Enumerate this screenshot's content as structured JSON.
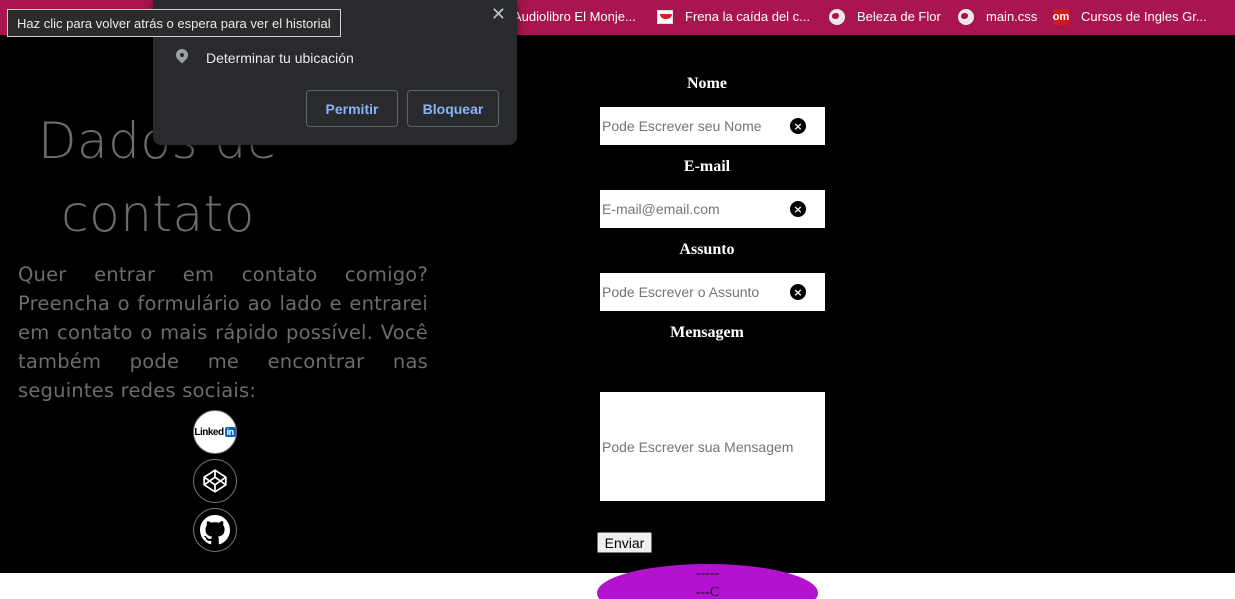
{
  "bookmarks": [
    {
      "label": "Audiolibro El Monje...",
      "icon": "bookmark-icon"
    },
    {
      "label": "Frena la caída del c...",
      "icon": "frena-favicon-icon"
    },
    {
      "label": "Beleza de Flor",
      "icon": "globe-icon"
    },
    {
      "label": "main.css",
      "icon": "globe-icon"
    },
    {
      "label": "Cursos de Ingles Gr...",
      "icon": "om-favicon-icon",
      "icon_text": "om"
    }
  ],
  "tooltip": "Haz clic para volver atrás o espera para ver el historial",
  "permission": {
    "request": "Determinar tu ubicación",
    "allow": "Permitir",
    "block": "Bloquear",
    "close": "✕"
  },
  "main": {
    "title_line1": "Dados de",
    "title_line2": "contato",
    "intro": "Quer entrar em contato comigo?Preencha o formulário ao lado e entrarei em contato o mais rápido possível. Você também pode me encontrar nas seguintes redes sociais:"
  },
  "socials": [
    {
      "name": "LinkedIn",
      "text": "Linked",
      "box": "in"
    },
    {
      "name": "CodePen"
    },
    {
      "name": "GitHub"
    }
  ],
  "form": {
    "name_label": "Nome",
    "name_placeholder": "Pode Escrever seu Nome",
    "email_label": "E-mail",
    "email_placeholder": "E-mail@email.com",
    "subject_label": "Assunto",
    "subject_placeholder": "Pode Escrever o Assunto",
    "message_label": "Mensagem",
    "message_placeholder": "Pode Escrever sua Mensagem",
    "clear_symbol": "×",
    "submit": "Enviar"
  },
  "blob": {
    "line1": "-----",
    "line2": "---C",
    "line3": "----"
  },
  "colors": {
    "bookmark_bar": "#a8154f",
    "page_bg": "#000000",
    "blob": "#b313cf",
    "popup_bg": "#292a2d",
    "popup_button_text": "#8ab4f8"
  }
}
